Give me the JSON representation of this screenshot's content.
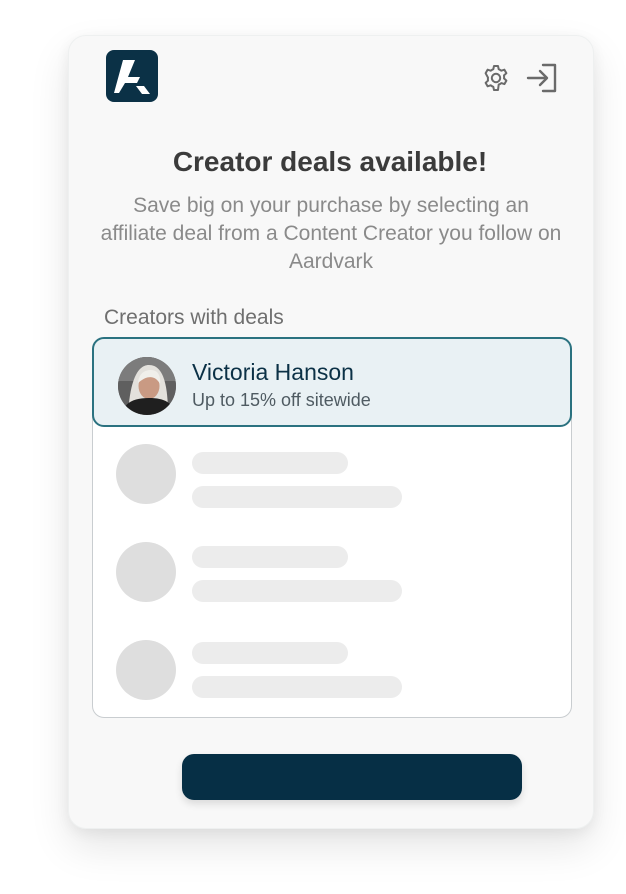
{
  "app": {
    "logo": "aardvark-logo",
    "icons": {
      "settings": "gear-icon",
      "signin": "sign-in-icon"
    }
  },
  "header": {
    "title": "Creator deals available!",
    "subtitle": "Save big on your purchase by selecting an affiliate deal from a Content Creator you follow on Aardvark"
  },
  "creators": {
    "section_label": "Creators with deals",
    "selected": {
      "name": "Victoria Hanson",
      "deal": "Up to 15% off sitewide"
    },
    "placeholder_rows": 3
  },
  "cta": {
    "label": ""
  },
  "colors": {
    "brand_navy": "#062f45",
    "accent_teal": "#2b7280",
    "selected_bg": "#e9f1f4",
    "placeholder": "#dedede"
  }
}
